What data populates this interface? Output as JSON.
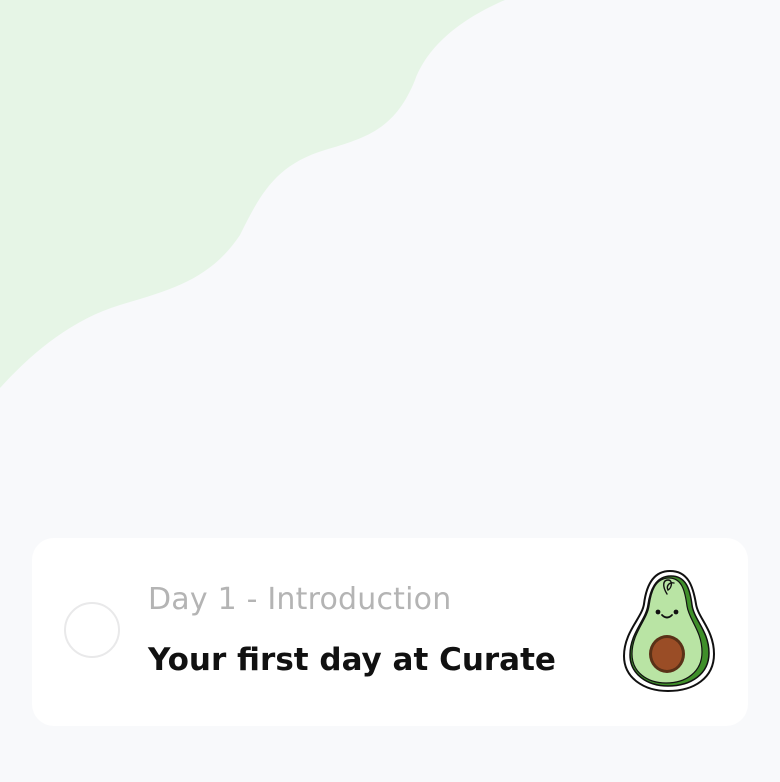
{
  "lesson_card": {
    "subtitle": "Day 1 - Introduction",
    "title": "Your first day at Curate",
    "illustration": "avocado-icon",
    "completed": false
  },
  "colors": {
    "page_background": "#f8f9fb",
    "wave": "#e6f5e6",
    "card_background": "#ffffff",
    "subtitle": "#b4b4b4",
    "title": "#111111"
  }
}
